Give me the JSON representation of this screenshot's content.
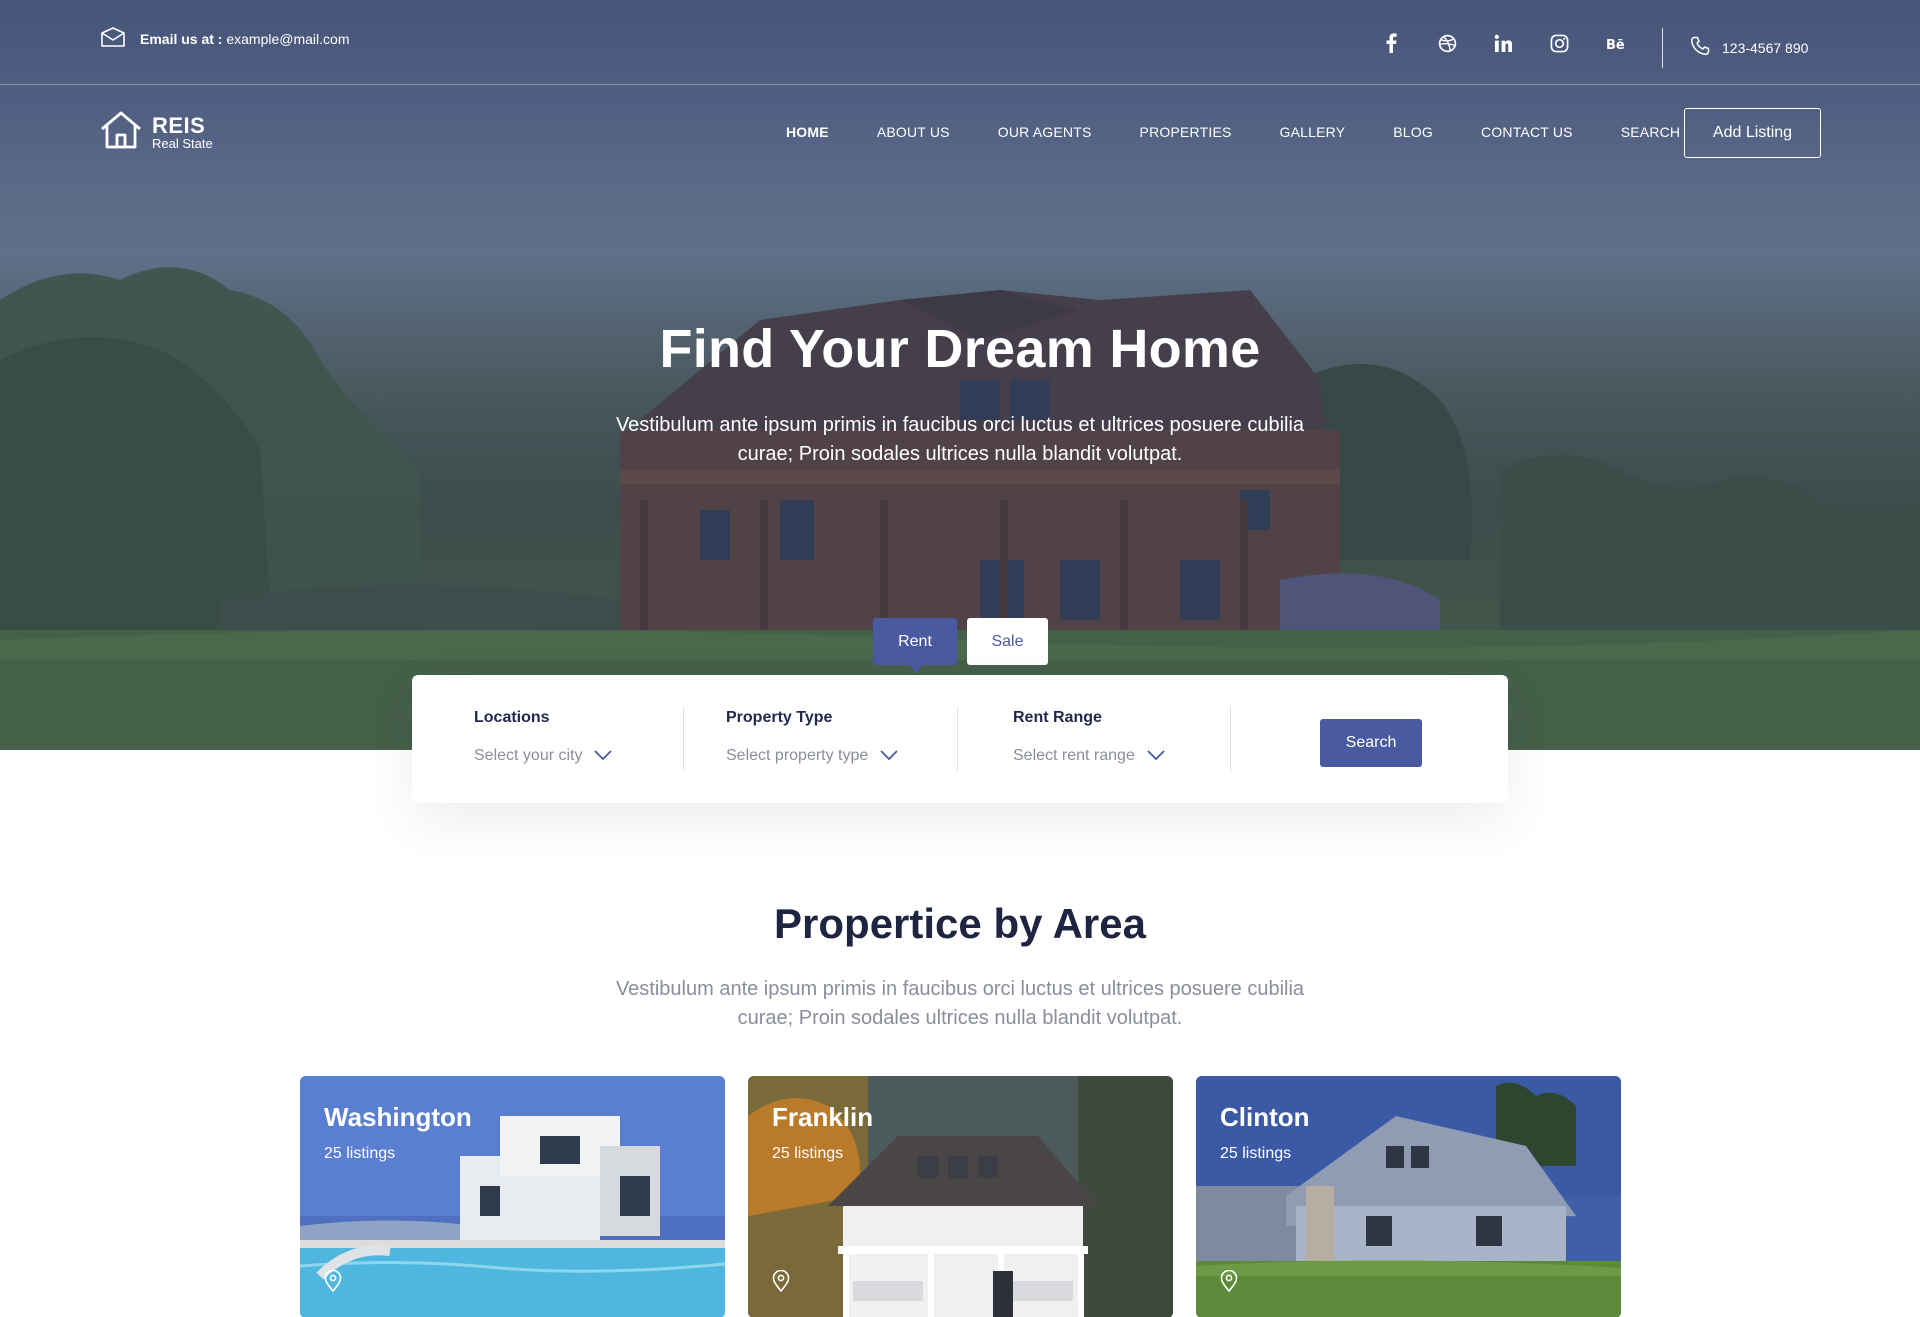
{
  "topbar": {
    "email_label": "Email us at :",
    "email_value": "example@mail.com",
    "socials": [
      "facebook-icon",
      "dribbble-icon",
      "linkedin-icon",
      "instagram-icon",
      "behance-icon"
    ],
    "phone": "123-4567 890"
  },
  "brand": {
    "name": "REIS",
    "tagline": "Real State"
  },
  "nav": {
    "items": [
      "HOME",
      "ABOUT US",
      "OUR AGENTS",
      "PROPERTIES",
      "GALLERY",
      "BLOG",
      "CONTACT US",
      "SEARCH"
    ],
    "active": "HOME",
    "cta": "Add Listing"
  },
  "hero": {
    "title": "Find Your Dream Home",
    "subtitle": "Vestibulum ante ipsum primis in faucibus orci luctus et ultrices posuere cubilia curae; Proin sodales ultrices nulla blandit volutpat."
  },
  "tabs": {
    "rent": "Rent",
    "sale": "Sale",
    "selected": "Rent"
  },
  "search": {
    "locations_label": "Locations",
    "locations_value": "Select your city",
    "type_label": "Property Type",
    "type_value": "Select property type",
    "range_label": "Rent Range",
    "range_value": "Select rent range",
    "button": "Search"
  },
  "section": {
    "title": "Propertice by Area",
    "subtitle": "Vestibulum ante ipsum primis in faucibus orci luctus et ultrices posuere cubilia curae; Proin sodales ultrices nulla blandit volutpat."
  },
  "areas": [
    {
      "name": "Washington",
      "count": "25 listings"
    },
    {
      "name": "Franklin",
      "count": "25 listings"
    },
    {
      "name": "Clinton",
      "count": "25 listings"
    }
  ],
  "colors": {
    "accent": "#4a5aa0",
    "heading": "#1f2540",
    "muted": "#8a8e9c"
  }
}
